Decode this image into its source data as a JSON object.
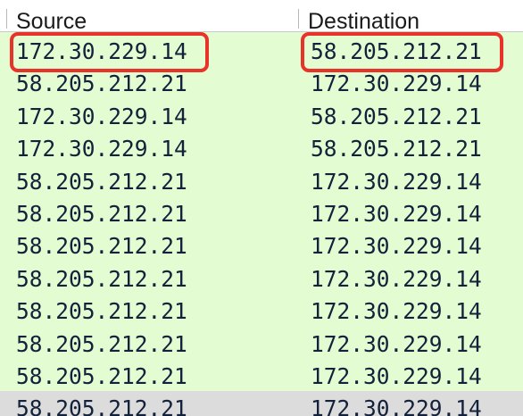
{
  "columns": {
    "source": "Source",
    "destination": "Destination"
  },
  "rows": [
    {
      "source": "172.30.229.14",
      "destination": "58.205.212.21",
      "highlighted": true
    },
    {
      "source": "58.205.212.21",
      "destination": "172.30.229.14"
    },
    {
      "source": "172.30.229.14",
      "destination": "58.205.212.21"
    },
    {
      "source": "172.30.229.14",
      "destination": "58.205.212.21"
    },
    {
      "source": "58.205.212.21",
      "destination": "172.30.229.14"
    },
    {
      "source": "58.205.212.21",
      "destination": "172.30.229.14"
    },
    {
      "source": "58.205.212.21",
      "destination": "172.30.229.14"
    },
    {
      "source": "58.205.212.21",
      "destination": "172.30.229.14"
    },
    {
      "source": "58.205.212.21",
      "destination": "172.30.229.14"
    },
    {
      "source": "58.205.212.21",
      "destination": "172.30.229.14"
    },
    {
      "source": "58.205.212.21",
      "destination": "172.30.229.14"
    },
    {
      "source": "58.205.212.21",
      "destination": "172.30.229.14",
      "selected": true
    }
  ],
  "colors": {
    "row_background": "#e4fcd2",
    "selected_row_background": "#dcdcdc",
    "annotation_box": "#e8332a"
  }
}
